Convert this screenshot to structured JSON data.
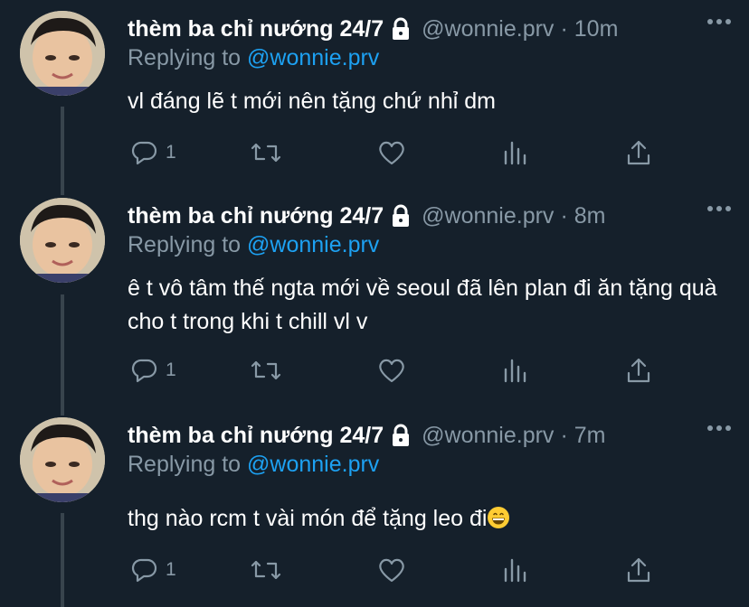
{
  "tweets": [
    {
      "display_name": "thèm ba chỉ nướng 24/7",
      "handle": "@wonnie.prv",
      "separator": "·",
      "time": "10m",
      "replying_prefix": "Replying to",
      "replying_to": "@wonnie.prv",
      "text": "vl đáng lẽ t mới nên tặng chứ nhỉ dm",
      "reply_count": "1"
    },
    {
      "display_name": "thèm ba chỉ nướng 24/7",
      "handle": "@wonnie.prv",
      "separator": "·",
      "time": "8m",
      "replying_prefix": "Replying to",
      "replying_to": "@wonnie.prv",
      "text": "ê t vô tâm thế ngta mới về seoul đã lên plan đi ăn tặng quà cho t trong khi t chill vl v",
      "reply_count": "1"
    },
    {
      "display_name": "thèm ba chỉ nướng 24/7",
      "handle": "@wonnie.prv",
      "separator": "·",
      "time": "7m",
      "replying_prefix": "Replying to",
      "replying_to": "@wonnie.prv",
      "text": "thg nào rcm t vài món để tặng leo đi",
      "reply_count": "1"
    }
  ],
  "icons": {
    "lock": "lock-icon",
    "more": "more-icon",
    "reply": "reply-icon",
    "retweet": "retweet-icon",
    "like": "heart-icon",
    "analytics": "analytics-icon",
    "share": "share-icon",
    "emoji": "grinning-face-emoji"
  },
  "colors": {
    "background": "#15202b",
    "secondary_text": "#8899a6",
    "mention": "#1da1f2",
    "thread_line": "#38444d"
  }
}
